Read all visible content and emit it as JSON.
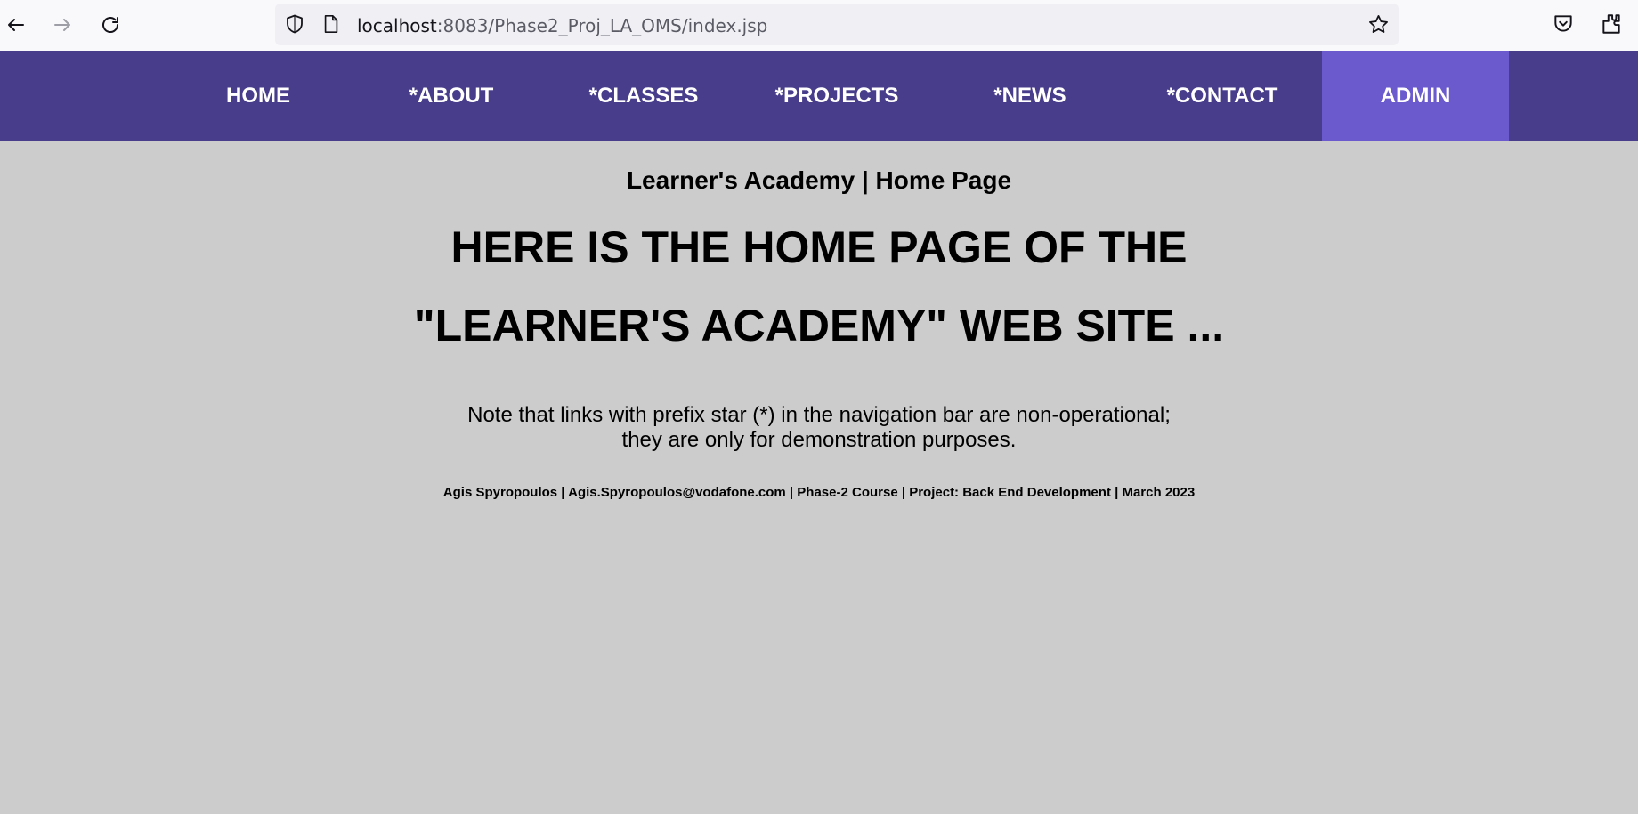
{
  "browser": {
    "url_host": "localhost",
    "url_rest": ":8083/Phase2_Proj_LA_OMS/index.jsp",
    "icons": [
      "back-icon",
      "forward-icon",
      "reload-icon",
      "shield-icon",
      "page-icon",
      "bookmark-star-icon",
      "pocket-icon",
      "extensions-icon"
    ]
  },
  "nav": {
    "items": [
      {
        "label": "HOME"
      },
      {
        "label": "*ABOUT"
      },
      {
        "label": "*CLASSES"
      },
      {
        "label": "*PROJECTS"
      },
      {
        "label": "*NEWS"
      },
      {
        "label": "*CONTACT"
      },
      {
        "label": "ADMIN"
      }
    ],
    "active": "ADMIN",
    "colors": {
      "bar": "#483d8b",
      "active": "#6a5acd",
      "text": "#ffffff"
    }
  },
  "main": {
    "title": "Learner's Academy | Home Page",
    "headline_line1": "HERE IS THE HOME PAGE OF THE",
    "headline_line2": "\"LEARNER'S ACADEMY\" WEB SITE ...",
    "note_line1": "Note that links with prefix star (*) in the navigation bar are non-operational;",
    "note_line2": "they are only for demonstration purposes.",
    "footer": "Agis Spyropoulos | Agis.Spyropoulos@vodafone.com | Phase-2 Course | Project: Back End Development | March 2023"
  },
  "colors": {
    "page_background": "#cccccc"
  }
}
